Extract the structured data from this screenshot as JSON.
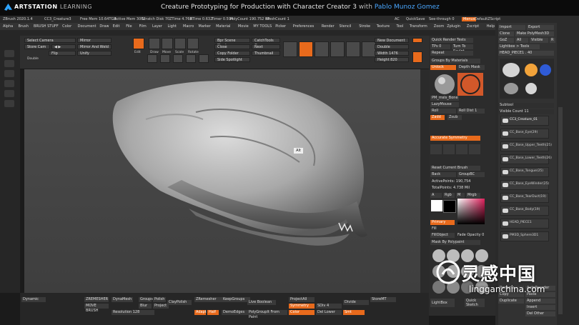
{
  "banner": {
    "brand_main": "ARTSTATION",
    "brand_sub": "LEARNING",
    "course_title": "Creature Prototyping for Production with Character Creator 3",
    "by": "with",
    "author": "Pablo Munoz Gomez"
  },
  "titlebar": {
    "app": "ZBrush 2020.1.4",
    "file": "CC3_Creature3",
    "free_mem": "Free Mem 10.64TGB",
    "active_mem": "Active Mem 3002",
    "scratch": "Scratch Disk 70",
    "ztime": "ZTime 4.768",
    "rtime": "RTime 0.632",
    "timer": "Timer 0.594",
    "polycount": "PolyCount 190.752 KP",
    "meshcount": "MeshCount 1",
    "ac": "AC",
    "quicksave": "QuickSave",
    "see_through": "See-through 0",
    "menus": "Menus",
    "default_zscript": "DefaultZScript"
  },
  "menubar": {
    "items": [
      "Alpha",
      "Brush",
      "BRUSH STUFF",
      "Color",
      "Document",
      "Draw",
      "Edit",
      "File",
      "Film",
      "Layer",
      "Light",
      "Macro",
      "Marker",
      "Material",
      "Movie",
      "MY TOOLS",
      "Picker",
      "Preferences",
      "Render",
      "Stencil",
      "Stroke",
      "Texture",
      "Tool",
      "Transform",
      "Zoom",
      "Zplugin",
      "Zscript",
      "Help"
    ]
  },
  "toolbar": {
    "select_camera": "Select Camera",
    "store_cam": "Store Cam",
    "mirror": "Mirror",
    "mirror_and_weld": "Mirror And Weld",
    "flip": "Flip",
    "unify": "Unify",
    "double": "Double",
    "edit": "Edit",
    "draw": "Draw",
    "move": "Move",
    "scale": "Scale",
    "rotate": "Rotate",
    "bpr_scene_shadow": "Bpr Scene Shadow",
    "close": "Close",
    "copy_folder": "Copy Folder",
    "thumbnail": "Thumbnail",
    "side_spotlight": "Side Spotlight",
    "catchtools_on": "CatchTools On",
    "next": "Next",
    "new_document": "New Document",
    "double2": "Double",
    "width": "Width 1476",
    "height": "Height 820",
    "quick_render_tests": "Quick Render Tests",
    "tps": "TPs 0",
    "turn_to_sculpt": "Turn To Sculpt",
    "repeat": "Repeat"
  },
  "midpanel": {
    "groups_by_materials": "Groups By Materials",
    "unlock": "Unlock",
    "depth_mask": "Depth Mask",
    "pm_matcap": "PM_msls_Bone",
    "lazymouse": "LazyMouse",
    "roll": "Roll",
    "roll_dist": "Roll Dist 1",
    "zadd": "Zadd",
    "zsub": "Zsub",
    "accurate_symmetry": "Accurate Symmetry",
    "reset_current_brush": "Reset Current Brush",
    "back": "Back",
    "group_bc": "GroupBC",
    "active_points": "ActivePoints: 190,754",
    "total_points": "TotalPoints: 4.738 Mil",
    "rgb": "Rgb",
    "m": "M",
    "mrgb": "Mrgb",
    "fill_object": "FillObject",
    "fade_opacity": "Fade Opacity 0",
    "mask_by_polypaint": "Mask By Polypaint",
    "lightbox": "LightBox",
    "quick_sketch": "Quick Sketch"
  },
  "rightpanel": {
    "import": "Import",
    "export": "Export",
    "clone": "Clone",
    "make_polymesh": "Make PolyMesh3D",
    "goz": "GoZ",
    "all": "All",
    "visible": "Visible",
    "r": "R",
    "lightbox_tools": "Lightbox > Tools",
    "head_piece": "HEAD_PIECE1 . 40",
    "subtool_header": "Subtool",
    "visible_count": "Visible Count 11",
    "subtools": [
      "CC3_Creature_01",
      "CC_Base_Eye(29)",
      "CC_Base_Upper_Teeth(25)",
      "CC_Base_Lower_Teeth(26)",
      "CC_Base_Tongue(25)",
      "CC_Base_EyeWinder(25)",
      "CC_Base_TearDuct(19)",
      "CC_Base_Body(19)",
      "HEAD_PIECE1",
      "PM3D_Sphere3D1"
    ],
    "rename": "Rename",
    "auto_reorder": "AutoReorder",
    "copy": "Copy",
    "paste": "Paste",
    "duplicate": "Duplicate",
    "append": "Append",
    "insert": "Insert",
    "del_other": "Del Other"
  },
  "bottombar": {
    "dynamic": "Dynamic",
    "zremesher": "ZREMESHER",
    "move_brush": "MOVE BRUSH",
    "dynamesh": "DynaMesh",
    "groups": "Groups",
    "polish": "Polish",
    "blur": "Blur",
    "project": "Project",
    "resolution": "Resolution 128",
    "clay_polish": "ClayPolish",
    "zremesher2": "ZRemesher",
    "keep_groups": "KeepGroups",
    "live_boolean": "Live Boolean",
    "polygroupit": "PolyGroupIt From Paint",
    "projectall": "ProjectAll",
    "symmetry": "Symmetry",
    "sdiv": "SDiv 4",
    "divide": "Divide",
    "store_mt": "StoreMT",
    "del_lower": "Del Lower",
    "adapt": "Adapt",
    "half": "Half",
    "demo_edges": "DemoEdges"
  },
  "viewport": {
    "tooltip": "Alt"
  },
  "watermark": {
    "cn": "灵感中国",
    "url": "lingganchina.com"
  }
}
